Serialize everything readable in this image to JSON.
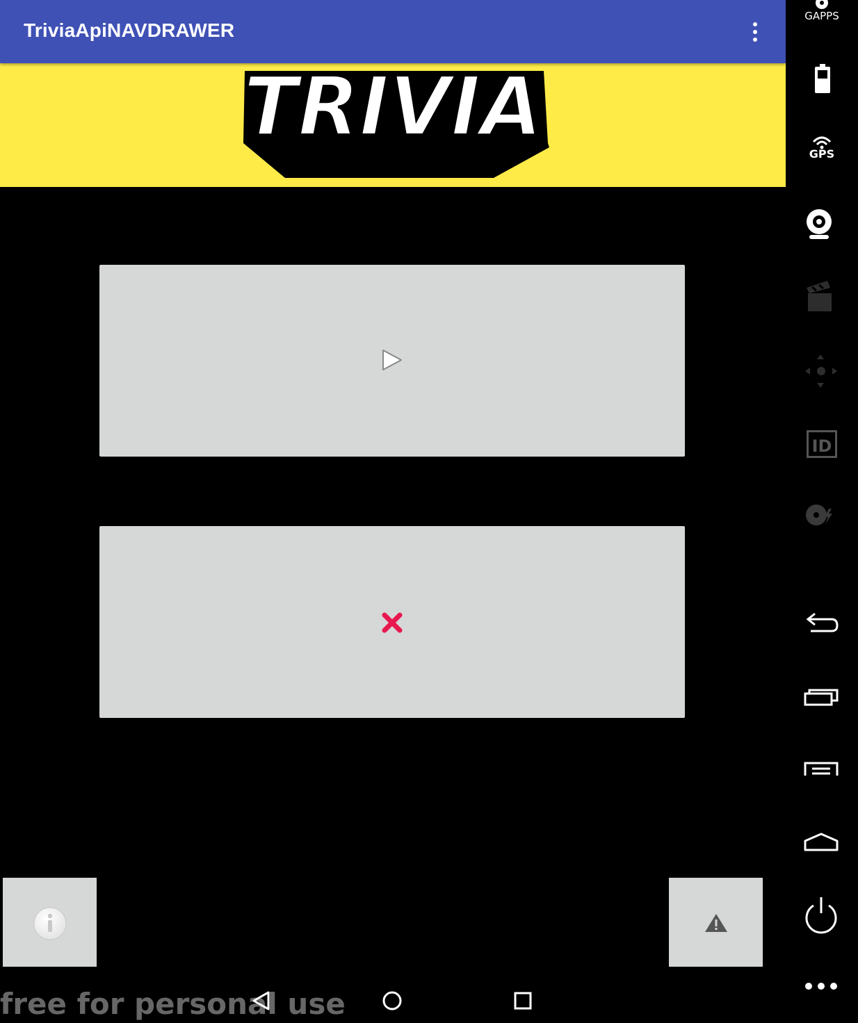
{
  "app": {
    "title": "TriviaApiNAVDRAWER",
    "overflow_icon": "more-vert-icon",
    "banner_color": "#ffeb48",
    "appbar_color": "#3f51b5",
    "logo_text": "TRIVIA"
  },
  "buttons": {
    "play_icon": "play-icon",
    "exit_icon": "close-x-icon",
    "info_icon": "info-icon",
    "warning_icon": "warning-icon",
    "button_color": "#d6d7d7",
    "exit_icon_color": "#e8184f"
  },
  "watermark": "free for personal use",
  "navbar": {
    "back_icon": "back-triangle-icon",
    "home_icon": "home-circle-icon",
    "recents_icon": "recents-square-icon"
  },
  "sidebar": {
    "gapps_label": "GAPPS",
    "gps_label": "GPS",
    "id_label": "ID",
    "tools": [
      "gapps-icon",
      "battery-icon",
      "gps-icon",
      "webcam-icon",
      "clapperboard-icon",
      "dpad-icon",
      "id-icon",
      "disk-icon",
      "back-icon",
      "recent-apps-icon",
      "menu-icon",
      "home-icon",
      "power-icon",
      "more-icon"
    ]
  }
}
